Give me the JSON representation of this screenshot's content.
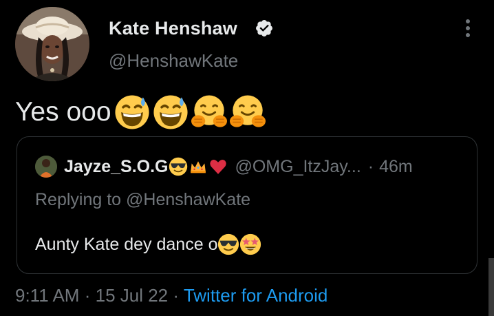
{
  "author": {
    "display_name": "Kate Henshaw",
    "handle": "@HenshawKate",
    "verified": true,
    "avatar_icon": "profile-photo"
  },
  "tweet": {
    "text": "Yes ooo",
    "emojis": [
      "grinning-sweat-emoji",
      "grinning-sweat-emoji",
      "hugging-face-emoji",
      "hugging-face-emoji"
    ]
  },
  "quoted_tweet": {
    "display_name": "Jayze_S.O.G",
    "name_emojis": [
      "sunglasses-emoji",
      "crown-emoji",
      "red-heart-emoji"
    ],
    "handle": "@OMG_ItzJay...",
    "separator": "·",
    "time": "46m",
    "replying_to": "Replying to @HenshawKate",
    "text": "Aunty Kate dey dance o",
    "text_emojis": [
      "sunglasses-emoji",
      "star-struck-emoji"
    ]
  },
  "footer": {
    "time": "9:11 AM",
    "sep1": "·",
    "date": "15 Jul 22",
    "sep2": "·",
    "source": "Twitter for Android"
  },
  "colors": {
    "background": "#000000",
    "text_primary": "#e7e9ea",
    "text_secondary": "#71767b",
    "link": "#1d9bf0",
    "border": "#2f3336"
  }
}
